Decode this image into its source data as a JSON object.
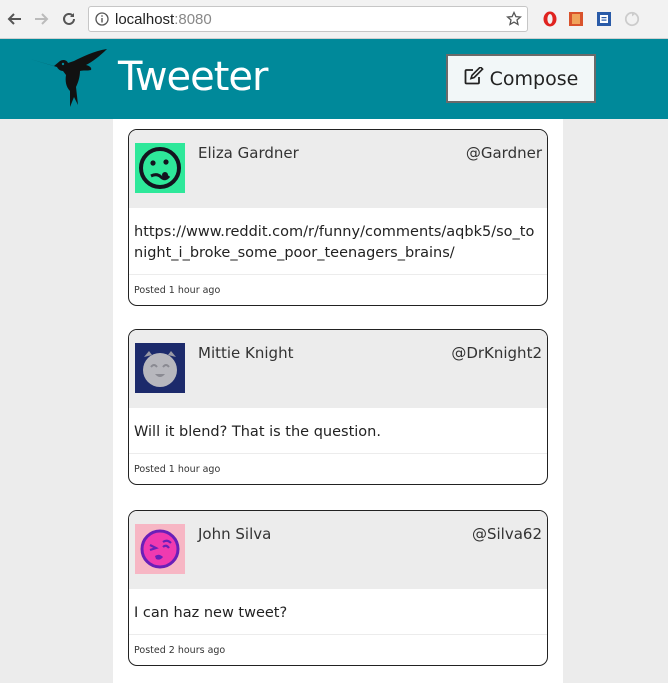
{
  "browser": {
    "url_host": "localhost",
    "url_port": ":8080",
    "icons": [
      "back-arrow-icon",
      "forward-arrow-icon",
      "reload-icon",
      "info-icon",
      "star-icon",
      "opera-icon",
      "bookmark-ext-icon",
      "reader-ext-icon",
      "refresh-ext-icon"
    ]
  },
  "header": {
    "title": "Tweeter",
    "compose_label": "Compose",
    "background_color": "#00899a"
  },
  "tweets": [
    {
      "name": "Eliza Gardner",
      "handle": "@Gardner",
      "text": "https://www.reddit.com/r/funny/comments/aqbk5/so_tonight_i_broke_some_poor_teenagers_brains/",
      "posted": "Posted 1 hour ago",
      "avatar_bg": "#2ee89a"
    },
    {
      "name": "Mittie Knight",
      "handle": "@DrKnight2",
      "text": "Will it blend? That is the question.",
      "posted": "Posted 1 hour ago",
      "avatar_bg": "#1c2a6b"
    },
    {
      "name": "John Silva",
      "handle": "@Silva62",
      "text": "I can haz new tweet?",
      "posted": "Posted 2 hours ago",
      "avatar_bg": "#f7b6c4"
    }
  ]
}
